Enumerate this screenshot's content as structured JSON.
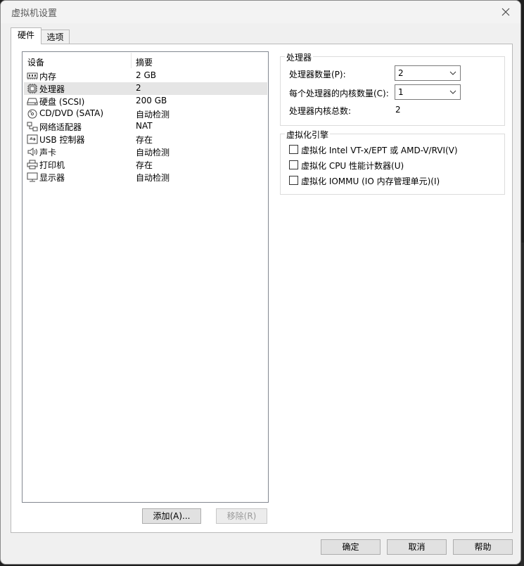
{
  "window": {
    "title": "虚拟机设置"
  },
  "tabs": [
    {
      "label": "硬件",
      "active": true
    },
    {
      "label": "选项",
      "active": false
    }
  ],
  "device_list": {
    "columns": [
      "设备",
      "摘要"
    ],
    "rows": [
      {
        "name": "内存",
        "summary": "2 GB",
        "icon": "memory-icon"
      },
      {
        "name": "处理器",
        "summary": "2",
        "icon": "processor-icon",
        "selected": true
      },
      {
        "name": "硬盘 (SCSI)",
        "summary": "200 GB",
        "icon": "hard-disk-icon"
      },
      {
        "name": "CD/DVD (SATA)",
        "summary": "自动检测",
        "icon": "cd-dvd-icon"
      },
      {
        "name": "网络适配器",
        "summary": "NAT",
        "icon": "network-adapter-icon"
      },
      {
        "name": "USB 控制器",
        "summary": "存在",
        "icon": "usb-icon"
      },
      {
        "name": "声卡",
        "summary": "自动检测",
        "icon": "sound-card-icon"
      },
      {
        "name": "打印机",
        "summary": "存在",
        "icon": "printer-icon"
      },
      {
        "name": "显示器",
        "summary": "自动检测",
        "icon": "display-icon"
      }
    ],
    "add_button": "添加(A)...",
    "remove_button": "移除(R)"
  },
  "processor": {
    "group_label": "处理器",
    "count_label": "处理器数量(P):",
    "count_value": "2",
    "cores_label": "每个处理器的内核数量(C):",
    "cores_value": "1",
    "total_label": "处理器内核总数:",
    "total_value": "2"
  },
  "virtualization": {
    "group_label": "虚拟化引擎",
    "options": [
      {
        "label": "虚拟化 Intel VT-x/EPT 或 AMD-V/RVI(V)",
        "checked": false
      },
      {
        "label": "虚拟化 CPU 性能计数器(U)",
        "checked": false
      },
      {
        "label": "虚拟化 IOMMU (IO 内存管理单元)(I)",
        "checked": false
      }
    ]
  },
  "footer": {
    "ok": "确定",
    "cancel": "取消",
    "help": "帮助"
  }
}
